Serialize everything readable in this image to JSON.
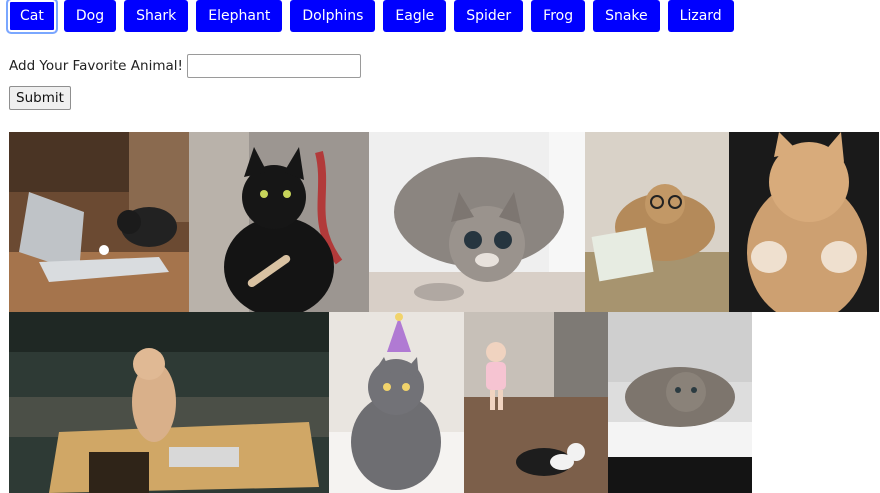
{
  "animal_buttons": [
    "Cat",
    "Dog",
    "Shark",
    "Elephant",
    "Dolphins",
    "Eagle",
    "Spider",
    "Frog",
    "Snake",
    "Lizard"
  ],
  "form": {
    "label": "Add Your Favorite Animal!",
    "input_value": "",
    "input_placeholder": "",
    "submit_label": "Submit"
  },
  "colors": {
    "button_bg": "#0000ff",
    "button_text": "#ffffff"
  },
  "gallery": {
    "images": [
      {
        "name": "cat-laptop-gif"
      },
      {
        "name": "black-cat-nail-file-gif"
      },
      {
        "name": "tabby-cat-crouch-gif"
      },
      {
        "name": "cat-glasses-book-gif"
      },
      {
        "name": "orange-cat-paws-gif"
      },
      {
        "name": "cat-standing-table-gif"
      },
      {
        "name": "gray-cat-party-hat-gif"
      },
      {
        "name": "toddler-cat-gif"
      },
      {
        "name": "tabby-cat-bed-gif"
      }
    ]
  }
}
